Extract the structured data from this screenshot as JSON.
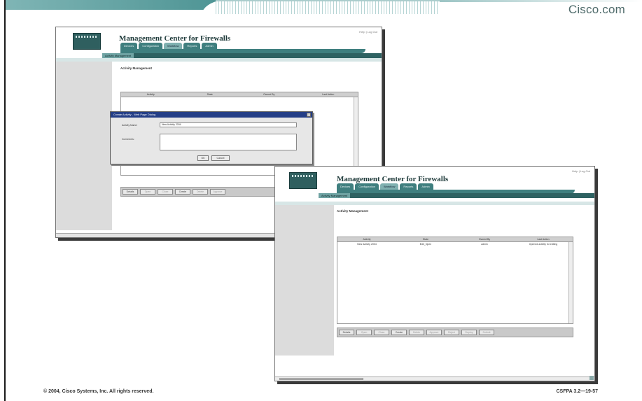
{
  "brand": "Cisco.com",
  "footer": {
    "copyright": "© 2004, Cisco Systems, Inc. All rights reserved.",
    "course_code": "CSFPA 3.2—19-57"
  },
  "window1": {
    "title": "Management Center for Firewalls",
    "tabs": [
      "Devices",
      "Configuration",
      "Workflow",
      "Reports",
      "Admin"
    ],
    "subnav_active": "Activity Management",
    "page_title": "Activity Management",
    "grid_headers": [
      "Activity",
      "State",
      "Owned By",
      "Last Action"
    ],
    "buttons": [
      "Details",
      "Open",
      "Close",
      "Create",
      "Delete",
      "Approve"
    ],
    "dialog": {
      "title": "Create Activity - Web Page Dialog",
      "name_label": "Activity Name:",
      "name_value": "New Activity 2004",
      "comments_label": "Comments:",
      "ok_label": "OK",
      "cancel_label": "Cancel"
    }
  },
  "window2": {
    "title": "Management Center for Firewalls",
    "tabs": [
      "Devices",
      "Configuration",
      "Workflow",
      "Reports",
      "Admin"
    ],
    "subnav_active": "Activity Management",
    "page_title": "Activity Management",
    "grid_headers": [
      "Activity",
      "State",
      "Owned By",
      "Last Action"
    ],
    "rows": [
      {
        "activity": "New Activity 2004",
        "state": "Edit_Open",
        "owner": "admin",
        "last_action": "Opened activity for editing"
      }
    ],
    "buttons": [
      "Details",
      "Open",
      "Close",
      "Create",
      "Delete",
      "Approve",
      "Reject",
      "Deploy",
      "Submit"
    ]
  },
  "colors": {
    "accent": "#3f7f7f",
    "dialog_title": "#243e86"
  }
}
